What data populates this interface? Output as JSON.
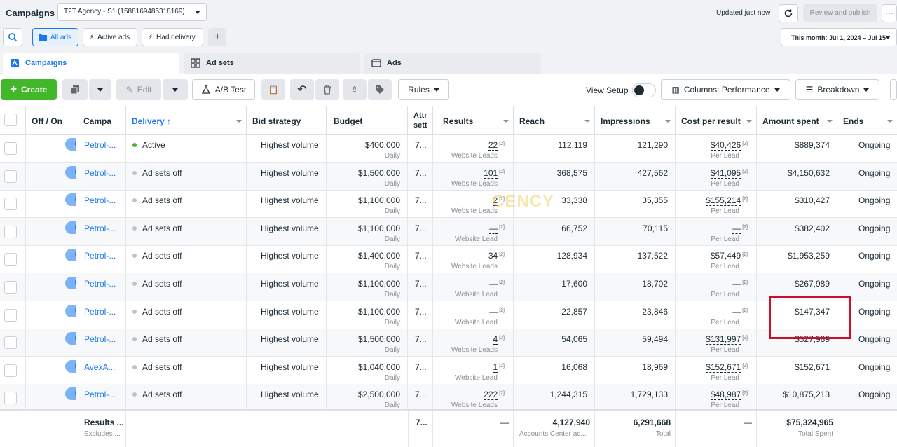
{
  "header": {
    "title": "Campaigns",
    "account": "T2T Agency - S1 (1588169485318169)",
    "updated": "Updated just now",
    "publish_label": "Review and publish",
    "more_label": "···"
  },
  "filters": {
    "all_ads": "All ads",
    "active_ads": "Active ads",
    "had_delivery": "Had delivery",
    "add": "+",
    "date_range": "This month: Jul 1, 2024 – Jul 15"
  },
  "tabs": {
    "campaigns": "Campaigns",
    "ad_sets": "Ad sets",
    "ads": "Ads"
  },
  "toolbar": {
    "create": "Create",
    "edit": "Edit",
    "ab_test": "A/B Test",
    "rules": "Rules",
    "view_setup": "View Setup",
    "columns": "Columns: Performance",
    "breakdown": "Breakdown"
  },
  "columns": {
    "off_on": "Off / On",
    "campaign": "Campa",
    "delivery": "Delivery ↑",
    "bid_strategy": "Bid strategy",
    "budget": "Budget",
    "attribution": "Attr sett",
    "results": "Results",
    "reach": "Reach",
    "impressions": "Impressions",
    "cost_per_result": "Cost per result",
    "amount_spent": "Amount spent",
    "ends": "Ends"
  },
  "rows": [
    {
      "name": "Petrol-...",
      "delivery": "Active",
      "delivery_color": "#42b72a",
      "bid": "Highest volume",
      "budget": "$400,000",
      "budget_sub": "Daily",
      "attr": "7...",
      "results": "22",
      "results_sub": "Website Leads",
      "reach": "112,119",
      "impressions": "121,290",
      "cpr": "$40,426",
      "cpr_sub": "Per Lead",
      "spent": "$889,374",
      "ends": "Ongoing"
    },
    {
      "name": "Petrol-...",
      "delivery": "Ad sets off",
      "delivery_color": "#bec3c9",
      "bid": "Highest volume",
      "budget": "$1,500,000",
      "budget_sub": "Daily",
      "attr": "7...",
      "results": "101",
      "results_sub": "Website Leads",
      "reach": "368,575",
      "impressions": "427,562",
      "cpr": "$41,095",
      "cpr_sub": "Per Lead",
      "spent": "$4,150,632",
      "ends": "Ongoing"
    },
    {
      "name": "Petrol-...",
      "delivery": "Ad sets off",
      "delivery_color": "#bec3c9",
      "bid": "Highest volume",
      "budget": "$1,100,000",
      "budget_sub": "Daily",
      "attr": "7...",
      "results": "2",
      "results_sub": "Website Leads",
      "reach": "33,338",
      "impressions": "35,355",
      "cpr": "$155,214",
      "cpr_sub": "Per Lead",
      "spent": "$310,427",
      "ends": "Ongoing"
    },
    {
      "name": "Petrol-...",
      "delivery": "Ad sets off",
      "delivery_color": "#bec3c9",
      "bid": "Highest volume",
      "budget": "$1,100,000",
      "budget_sub": "Daily",
      "attr": "7...",
      "results": "—",
      "results_sub": "Website Lead",
      "reach": "66,752",
      "impressions": "70,115",
      "cpr": "—",
      "cpr_sub": "Per Lead",
      "spent": "$382,402",
      "ends": "Ongoing"
    },
    {
      "name": "Petrol-...",
      "delivery": "Ad sets off",
      "delivery_color": "#bec3c9",
      "bid": "Highest volume",
      "budget": "$1,400,000",
      "budget_sub": "Daily",
      "attr": "7...",
      "results": "34",
      "results_sub": "Website Leads",
      "reach": "128,934",
      "impressions": "137,522",
      "cpr": "$57,449",
      "cpr_sub": "Per Lead",
      "spent": "$1,953,259",
      "ends": "Ongoing"
    },
    {
      "name": "Petrol-...",
      "delivery": "Ad sets off",
      "delivery_color": "#bec3c9",
      "bid": "Highest volume",
      "budget": "$1,100,000",
      "budget_sub": "Daily",
      "attr": "7...",
      "results": "—",
      "results_sub": "Website Lead",
      "reach": "17,600",
      "impressions": "18,702",
      "cpr": "—",
      "cpr_sub": "Per Lead",
      "spent": "$267,989",
      "ends": "Ongoing"
    },
    {
      "name": "Petrol-...",
      "delivery": "Ad sets off",
      "delivery_color": "#bec3c9",
      "bid": "Highest volume",
      "budget": "$1,100,000",
      "budget_sub": "Daily",
      "attr": "7...",
      "results": "—",
      "results_sub": "Website Lead",
      "reach": "22,857",
      "impressions": "23,846",
      "cpr": "—",
      "cpr_sub": "Per Lead",
      "spent": "$147,347",
      "ends": "Ongoing"
    },
    {
      "name": "Petrol-...",
      "delivery": "Ad sets off",
      "delivery_color": "#bec3c9",
      "bid": "Highest volume",
      "budget": "$1,500,000",
      "budget_sub": "Daily",
      "attr": "7...",
      "results": "4",
      "results_sub": "Website Leads",
      "reach": "54,065",
      "impressions": "59,494",
      "cpr": "$131,997",
      "cpr_sub": "Per Lead",
      "spent": "$527,989",
      "ends": "Ongoing"
    },
    {
      "name": "AvexA...",
      "delivery": "Ad sets off",
      "delivery_color": "#bec3c9",
      "bid": "Highest volume",
      "budget": "$1,040,000",
      "budget_sub": "Daily",
      "attr": "7...",
      "results": "1",
      "results_sub": "Website Lead",
      "reach": "16,068",
      "impressions": "18,969",
      "cpr": "$152,671",
      "cpr_sub": "Per Lead",
      "spent": "$152,671",
      "ends": "Ongoing"
    },
    {
      "name": "Petrol-...",
      "delivery": "Ad sets off",
      "delivery_color": "#bec3c9",
      "bid": "Highest volume",
      "budget": "$2,500,000",
      "budget_sub": "Daily",
      "attr": "7...",
      "results": "222",
      "results_sub": "Website Leads",
      "reach": "1,244,315",
      "impressions": "1,729,133",
      "cpr": "$48,987",
      "cpr_sub": "Per Lead",
      "spent": "$10,875,213",
      "ends": "Ongoing"
    }
  ],
  "footer": {
    "label": "Results ...",
    "label_sub": "Excludes ...",
    "attr": "7...",
    "results": "—",
    "reach": "4,127,940",
    "reach_sub": "Accounts Center ac...",
    "impressions": "6,291,668",
    "impressions_sub": "Total",
    "cpr": "—",
    "spent": "$75,324,965",
    "spent_sub": "Total Spent"
  },
  "watermark": "CENCY",
  "colors": {
    "accent": "#1877f2",
    "create": "#42b72a",
    "highlight": "#c8102e"
  }
}
